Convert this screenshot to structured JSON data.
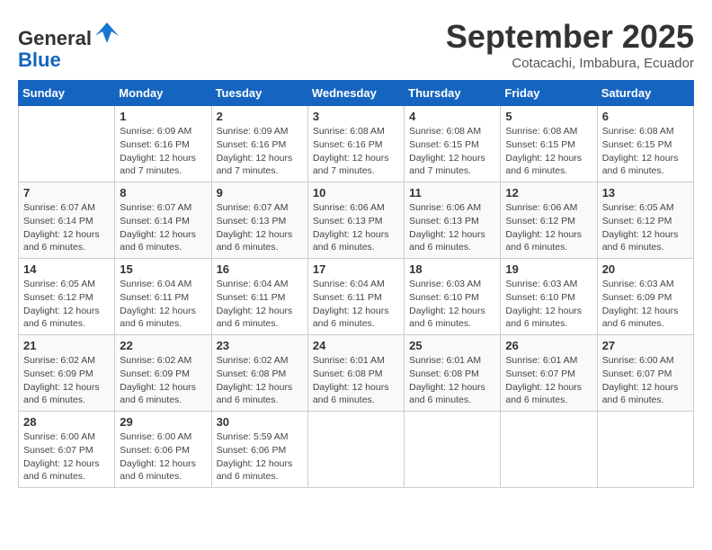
{
  "header": {
    "logo_general": "General",
    "logo_blue": "Blue",
    "month_title": "September 2025",
    "subtitle": "Cotacachi, Imbabura, Ecuador"
  },
  "days_of_week": [
    "Sunday",
    "Monday",
    "Tuesday",
    "Wednesday",
    "Thursday",
    "Friday",
    "Saturday"
  ],
  "weeks": [
    [
      {
        "day": "",
        "detail": ""
      },
      {
        "day": "1",
        "detail": "Sunrise: 6:09 AM\nSunset: 6:16 PM\nDaylight: 12 hours\nand 7 minutes."
      },
      {
        "day": "2",
        "detail": "Sunrise: 6:09 AM\nSunset: 6:16 PM\nDaylight: 12 hours\nand 7 minutes."
      },
      {
        "day": "3",
        "detail": "Sunrise: 6:08 AM\nSunset: 6:16 PM\nDaylight: 12 hours\nand 7 minutes."
      },
      {
        "day": "4",
        "detail": "Sunrise: 6:08 AM\nSunset: 6:15 PM\nDaylight: 12 hours\nand 7 minutes."
      },
      {
        "day": "5",
        "detail": "Sunrise: 6:08 AM\nSunset: 6:15 PM\nDaylight: 12 hours\nand 6 minutes."
      },
      {
        "day": "6",
        "detail": "Sunrise: 6:08 AM\nSunset: 6:15 PM\nDaylight: 12 hours\nand 6 minutes."
      }
    ],
    [
      {
        "day": "7",
        "detail": "Sunrise: 6:07 AM\nSunset: 6:14 PM\nDaylight: 12 hours\nand 6 minutes."
      },
      {
        "day": "8",
        "detail": "Sunrise: 6:07 AM\nSunset: 6:14 PM\nDaylight: 12 hours\nand 6 minutes."
      },
      {
        "day": "9",
        "detail": "Sunrise: 6:07 AM\nSunset: 6:13 PM\nDaylight: 12 hours\nand 6 minutes."
      },
      {
        "day": "10",
        "detail": "Sunrise: 6:06 AM\nSunset: 6:13 PM\nDaylight: 12 hours\nand 6 minutes."
      },
      {
        "day": "11",
        "detail": "Sunrise: 6:06 AM\nSunset: 6:13 PM\nDaylight: 12 hours\nand 6 minutes."
      },
      {
        "day": "12",
        "detail": "Sunrise: 6:06 AM\nSunset: 6:12 PM\nDaylight: 12 hours\nand 6 minutes."
      },
      {
        "day": "13",
        "detail": "Sunrise: 6:05 AM\nSunset: 6:12 PM\nDaylight: 12 hours\nand 6 minutes."
      }
    ],
    [
      {
        "day": "14",
        "detail": "Sunrise: 6:05 AM\nSunset: 6:12 PM\nDaylight: 12 hours\nand 6 minutes."
      },
      {
        "day": "15",
        "detail": "Sunrise: 6:04 AM\nSunset: 6:11 PM\nDaylight: 12 hours\nand 6 minutes."
      },
      {
        "day": "16",
        "detail": "Sunrise: 6:04 AM\nSunset: 6:11 PM\nDaylight: 12 hours\nand 6 minutes."
      },
      {
        "day": "17",
        "detail": "Sunrise: 6:04 AM\nSunset: 6:11 PM\nDaylight: 12 hours\nand 6 minutes."
      },
      {
        "day": "18",
        "detail": "Sunrise: 6:03 AM\nSunset: 6:10 PM\nDaylight: 12 hours\nand 6 minutes."
      },
      {
        "day": "19",
        "detail": "Sunrise: 6:03 AM\nSunset: 6:10 PM\nDaylight: 12 hours\nand 6 minutes."
      },
      {
        "day": "20",
        "detail": "Sunrise: 6:03 AM\nSunset: 6:09 PM\nDaylight: 12 hours\nand 6 minutes."
      }
    ],
    [
      {
        "day": "21",
        "detail": "Sunrise: 6:02 AM\nSunset: 6:09 PM\nDaylight: 12 hours\nand 6 minutes."
      },
      {
        "day": "22",
        "detail": "Sunrise: 6:02 AM\nSunset: 6:09 PM\nDaylight: 12 hours\nand 6 minutes."
      },
      {
        "day": "23",
        "detail": "Sunrise: 6:02 AM\nSunset: 6:08 PM\nDaylight: 12 hours\nand 6 minutes."
      },
      {
        "day": "24",
        "detail": "Sunrise: 6:01 AM\nSunset: 6:08 PM\nDaylight: 12 hours\nand 6 minutes."
      },
      {
        "day": "25",
        "detail": "Sunrise: 6:01 AM\nSunset: 6:08 PM\nDaylight: 12 hours\nand 6 minutes."
      },
      {
        "day": "26",
        "detail": "Sunrise: 6:01 AM\nSunset: 6:07 PM\nDaylight: 12 hours\nand 6 minutes."
      },
      {
        "day": "27",
        "detail": "Sunrise: 6:00 AM\nSunset: 6:07 PM\nDaylight: 12 hours\nand 6 minutes."
      }
    ],
    [
      {
        "day": "28",
        "detail": "Sunrise: 6:00 AM\nSunset: 6:07 PM\nDaylight: 12 hours\nand 6 minutes."
      },
      {
        "day": "29",
        "detail": "Sunrise: 6:00 AM\nSunset: 6:06 PM\nDaylight: 12 hours\nand 6 minutes."
      },
      {
        "day": "30",
        "detail": "Sunrise: 5:59 AM\nSunset: 6:06 PM\nDaylight: 12 hours\nand 6 minutes."
      },
      {
        "day": "",
        "detail": ""
      },
      {
        "day": "",
        "detail": ""
      },
      {
        "day": "",
        "detail": ""
      },
      {
        "day": "",
        "detail": ""
      }
    ]
  ]
}
